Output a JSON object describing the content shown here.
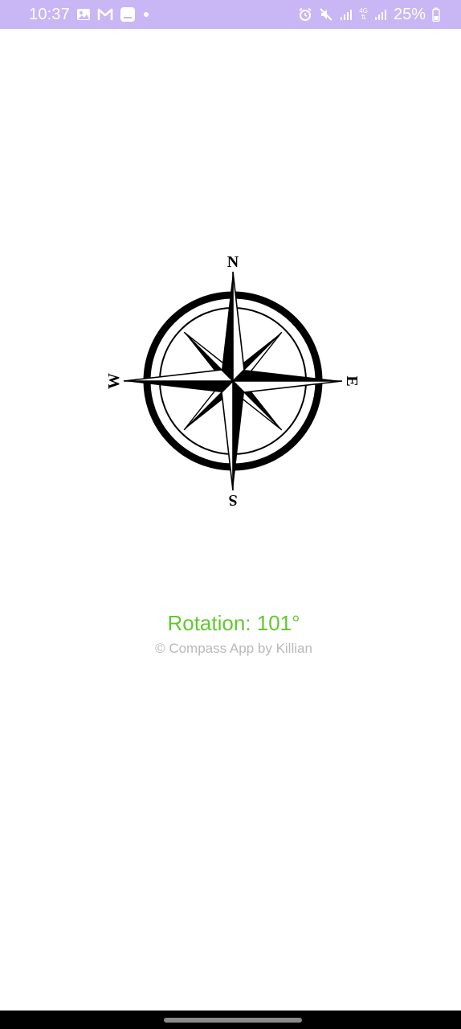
{
  "status_bar": {
    "time": "10:37",
    "battery": "25%",
    "network": "4G",
    "background_color": "#c9b6f5",
    "left_icons": [
      "gallery-icon",
      "gmail-icon",
      "notification-icon",
      "dot-icon"
    ],
    "right_icons": [
      "alarm-icon",
      "mute-icon",
      "signal-icon",
      "signal-4g-icon",
      "battery-icon"
    ]
  },
  "compass": {
    "rotation_degrees": 101,
    "labels": {
      "north": "N",
      "east": "E",
      "south": "S",
      "west": "W"
    }
  },
  "main": {
    "rotation_label": "Rotation: 101°",
    "rotation_color": "#63c832",
    "credit": "© Compass App by Killian",
    "credit_color": "#b9b9b9"
  },
  "nav_bar": {
    "background_color": "#000000"
  }
}
